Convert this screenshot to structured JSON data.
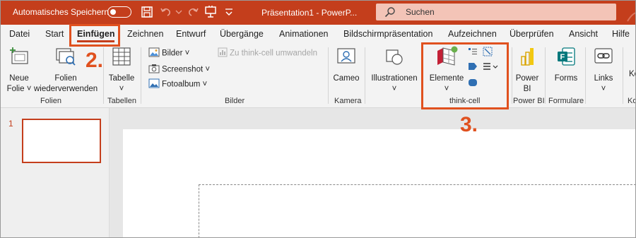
{
  "titlebar": {
    "autosave_label": "Automatisches Speichern",
    "document_title": "Präsentation1 - PowerP...",
    "search_placeholder": "Suchen"
  },
  "tabs": [
    "Datei",
    "Start",
    "Einfügen",
    "Zeichnen",
    "Entwurf",
    "Übergänge",
    "Animationen",
    "Bildschirmpräsentation",
    "Aufzeichnen",
    "Überprüfen",
    "Ansicht",
    "Hilfe"
  ],
  "ribbon": {
    "folien": {
      "neue_folie_line1": "Neue",
      "neue_folie_line2": "Folie ˅",
      "wiederverwenden_line1": "Folien",
      "wiederverwenden_line2": "wiederverwenden",
      "group_label": "Folien"
    },
    "tabellen": {
      "tabelle": "Tabelle",
      "group_label": "Tabellen"
    },
    "bilder": {
      "bilder": "Bilder ˅",
      "screenshot": "Screenshot ˅",
      "fotoalbum": "Fotoalbum ˅",
      "think_cell_convert": "Zu think-cell umwandeln",
      "group_label": "Bilder"
    },
    "kamera": {
      "cameo": "Cameo",
      "group_label": "Kamera"
    },
    "illustrationen": {
      "label": "Illustrationen"
    },
    "think_cell": {
      "elemente": "Elemente",
      "group_label": "think-cell"
    },
    "power_bi": {
      "line1": "Power",
      "line2": "BI",
      "group_label": "Power BI"
    },
    "formulare": {
      "forms": "Forms",
      "group_label": "Formulare"
    },
    "links": {
      "label": "Links"
    },
    "cut_off_label": "Ko",
    "cut_off_group": "Ko"
  },
  "slides": {
    "first_number": "1"
  },
  "annotations": {
    "step2": "2.",
    "step3": "3."
  },
  "colors": {
    "accent": "#c43e1c",
    "annotation": "#e0511f",
    "ribbon_bg": "#f3f3f3"
  }
}
